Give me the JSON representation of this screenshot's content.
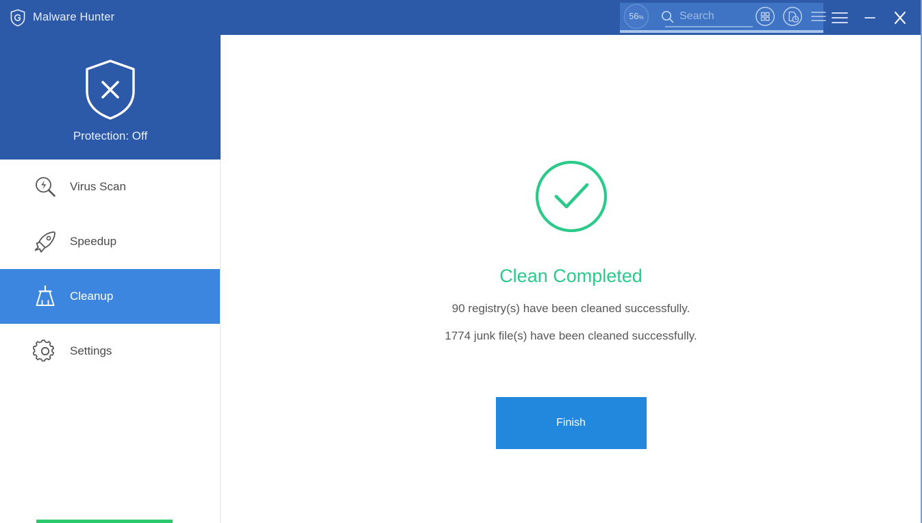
{
  "window": {
    "app_title": "Malware Hunter",
    "logo_icon": "shield-g-logo-icon",
    "controls": {
      "menu_label": "☰",
      "menu_icon": "hamburger-menu-icon",
      "minimize_label": "—",
      "minimize_icon": "minimize-icon",
      "close_label": "✕",
      "close_icon": "close-icon"
    }
  },
  "toolbar": {
    "gauge": {
      "icon": "circular-progress-gauge-icon",
      "value": "56",
      "unit": "%",
      "percent": 56
    },
    "search": {
      "icon": "search-icon",
      "value": "",
      "placeholder": "Search"
    },
    "grid_icon": "grid-apps-icon",
    "history_icon": "document-history-icon",
    "menu_icon": "hamburger-menu-icon"
  },
  "sidebar": {
    "protection": {
      "icon": "shield-off-icon",
      "label": "Protection: Off",
      "state": "Off"
    },
    "items": [
      {
        "id": "virus-scan",
        "label": "Virus Scan",
        "icon": "virus-scan-icon",
        "active": false
      },
      {
        "id": "speedup",
        "label": "Speedup",
        "icon": "rocket-icon",
        "active": false
      },
      {
        "id": "cleanup",
        "label": "Cleanup",
        "icon": "broom-icon",
        "active": true
      },
      {
        "id": "settings",
        "label": "Settings",
        "icon": "gear-icon",
        "active": false
      }
    ]
  },
  "main": {
    "status_icon": "check-circle-icon",
    "title": "Clean Completed",
    "lines": [
      "90 registry(s) have been cleaned successfully.",
      "1774 junk file(s) have been cleaned successfully."
    ],
    "primary_button": "Finish"
  },
  "colors": {
    "header_blue": "#2d5aa8",
    "toolbar_highlight": "#3f73c4",
    "toolbar_underline": "#a9c5ec",
    "active_nav_blue": "#3d86e0",
    "button_blue": "#2288dd",
    "success_green": "#2bc98a",
    "accent_green": "#2bc96b",
    "body_text": "#575757"
  }
}
